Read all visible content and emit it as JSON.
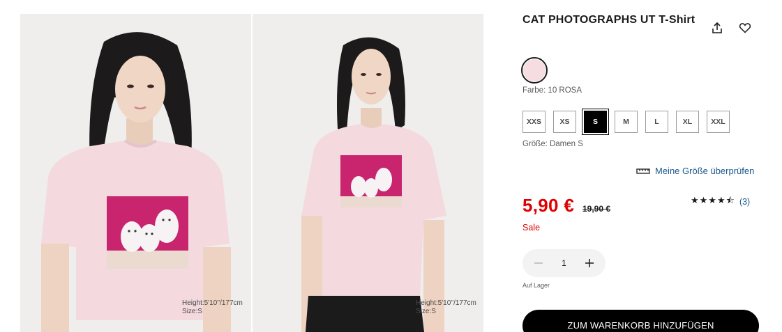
{
  "product": {
    "title": "CAT PHOTOGRAPHS UT T-Shirt",
    "color_label": "Farbe: 10 ROSA",
    "size_label": "Größe: Damen S",
    "size_check_label": "Meine Größe überprüfen",
    "price": "5,90 €",
    "old_price": "19,90 €",
    "sale_label": "Sale",
    "rating": {
      "stars": "★★★★⯪",
      "value_out_of_5": 4.5,
      "count": "(3)"
    },
    "quantity": "1",
    "stock_label": "Auf Lager",
    "cart_button": "ZUM WARENKORB HINZUFÜGEN",
    "sizes": [
      {
        "label": "XXS",
        "selected": false
      },
      {
        "label": "XS",
        "selected": false
      },
      {
        "label": "S",
        "selected": true
      },
      {
        "label": "M",
        "selected": false
      },
      {
        "label": "L",
        "selected": false
      },
      {
        "label": "XL",
        "selected": false
      },
      {
        "label": "XXL",
        "selected": false
      }
    ]
  },
  "gallery": [
    {
      "height": "Height:5'10''/177cm",
      "size": "Size:S"
    },
    {
      "height": "Height:5'10''/177cm",
      "size": "Size:S"
    }
  ],
  "icons": {
    "share": "share-icon",
    "favorite": "heart-icon",
    "ruler": "ruler-icon",
    "minus": "minus-icon",
    "plus": "plus-icon"
  },
  "colors": {
    "price_red": "#e00000",
    "link_blue": "#1d5a8e",
    "swatch_pink": "#f6dde1",
    "shirt_pink": "#f4d9df",
    "print_magenta": "#c9246e",
    "button_black": "#000000"
  }
}
